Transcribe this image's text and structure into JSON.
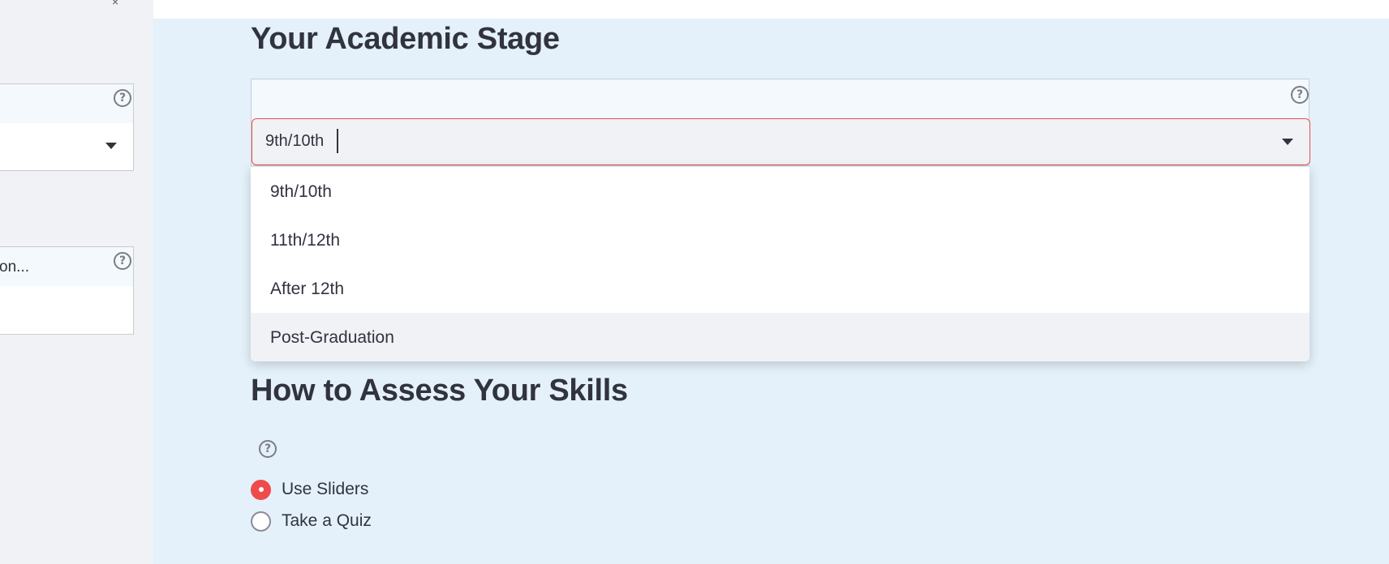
{
  "sidebar": {
    "close_glyph": "×",
    "box1": {
      "label": ""
    },
    "box2": {
      "label": "on..."
    }
  },
  "academic": {
    "heading": "Your Academic Stage",
    "select_value": "9th/10th",
    "options": [
      "9th/10th",
      "11th/12th",
      "After 12th",
      "Post-Graduation"
    ],
    "hovered_option": "Post-Graduation"
  },
  "assess": {
    "heading": "How to Assess Your Skills",
    "options": [
      "Use Sliders",
      "Take a Quiz"
    ],
    "selected": "Use Sliders"
  },
  "colors": {
    "accent": "#ef4b4b",
    "main_bg": "#e4f1fa",
    "sidebar_bg": "#f0f2f6"
  },
  "icons": {
    "help": "question-circle-icon",
    "dropdown": "caret-down-icon",
    "close": "close-icon"
  }
}
